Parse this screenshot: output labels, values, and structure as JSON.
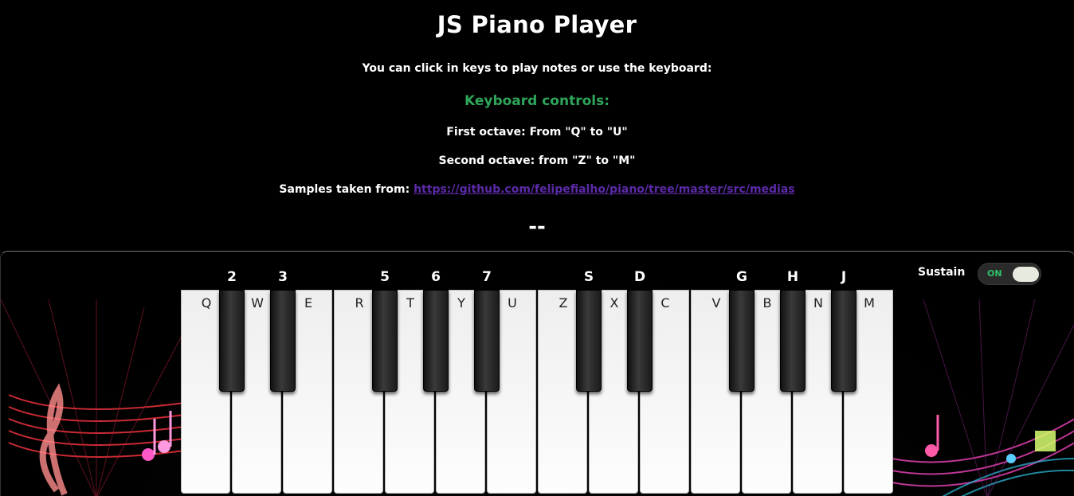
{
  "header": {
    "title": "JS Piano Player",
    "instructions": "You can click in keys to play notes or use the keyboard:",
    "controls_heading": "Keyboard controls:",
    "first_octave": "First octave: From \"Q\" to \"U\"",
    "second_octave": "Second octave: from \"Z\" to \"M\"",
    "samples_prefix": "Samples taken from: ",
    "samples_link": "https://github.com/felipefialho/piano/tree/master/src/medias",
    "note_display": "--"
  },
  "sustain": {
    "label": "Sustain",
    "state": "ON"
  },
  "white_keys": [
    "Q",
    "W",
    "E",
    "R",
    "T",
    "Y",
    "U",
    "Z",
    "X",
    "C",
    "V",
    "B",
    "N",
    "M"
  ],
  "black_keys": [
    "2",
    "3",
    "5",
    "6",
    "7",
    "S",
    "D",
    "G",
    "H",
    "J"
  ],
  "colors": {
    "controls_heading": "#2ea55a",
    "link": "#5b2aa8",
    "toggle_on": "#2ec16a"
  }
}
